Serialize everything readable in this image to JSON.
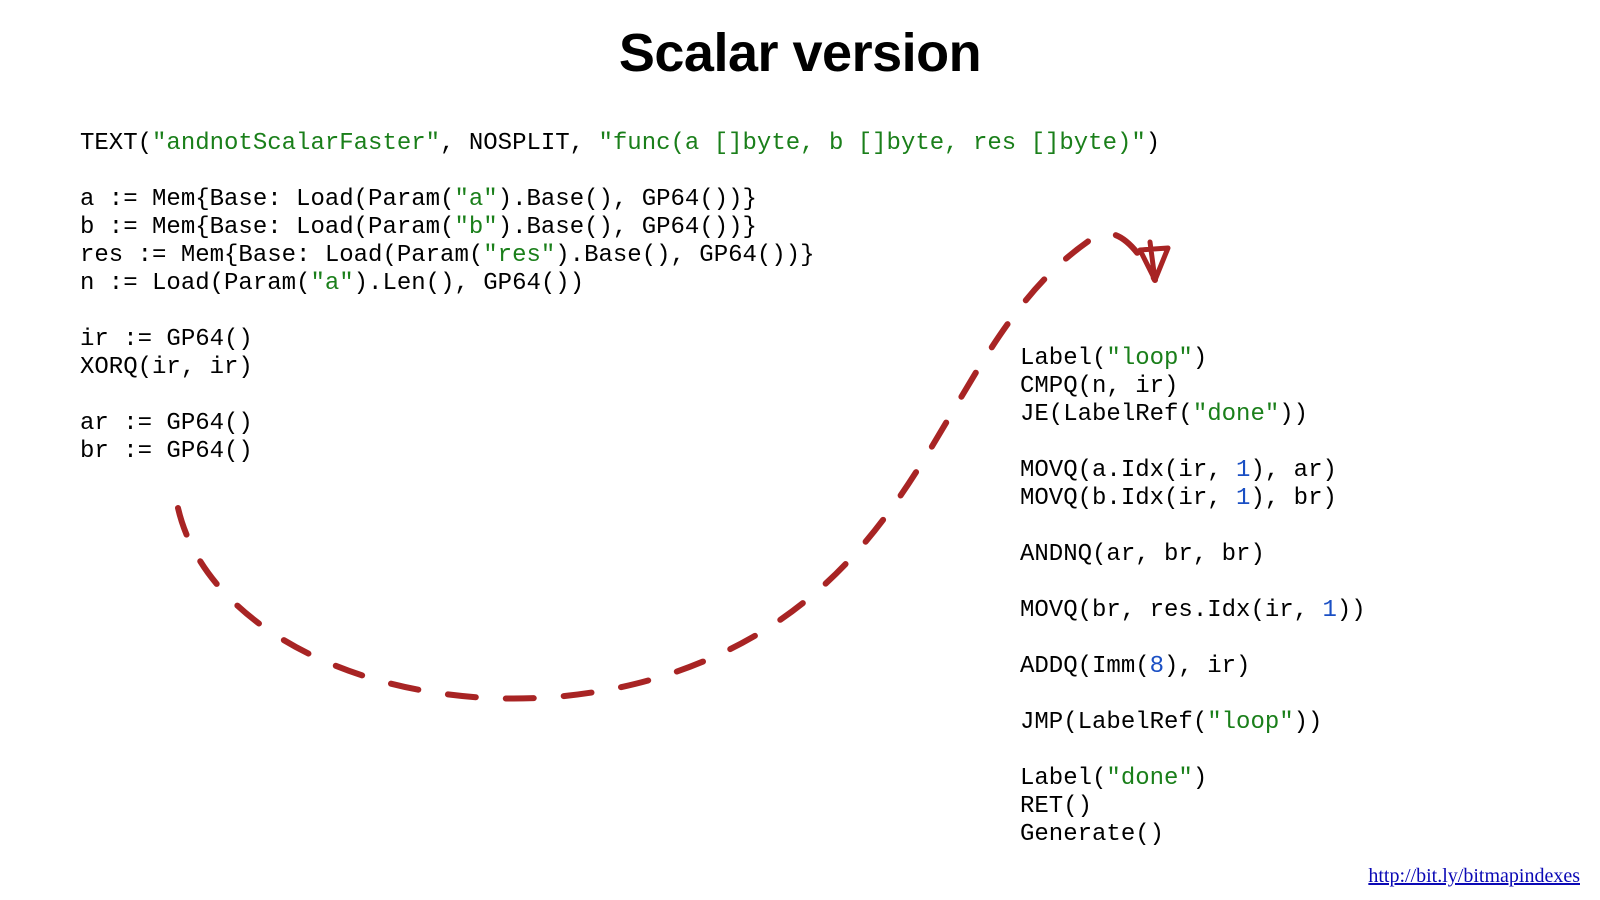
{
  "title": "Scalar version",
  "footer_link": "http://bit.ly/bitmapindexes",
  "strings": {
    "fn_name": "\"andnotScalarFaster\"",
    "fn_sig": "\"func(a []byte, b []byte, res []byte)\"",
    "a": "\"a\"",
    "b": "\"b\"",
    "res": "\"res\"",
    "loop": "\"loop\"",
    "done": "\"done\""
  },
  "nums": {
    "one_a": "1",
    "one_b": "1",
    "one_c": "1",
    "eight": "8"
  },
  "tokens": {
    "left_l1a": "TEXT(",
    "left_l1b": ", NOSPLIT, ",
    "left_l1c": ")",
    "left_l3a": "a := Mem{Base: Load(Param(",
    "left_l3b": ").Base(), GP64())}",
    "left_l4a": "b := Mem{Base: Load(Param(",
    "left_l4b": ").Base(), GP64())}",
    "left_l5a": "res := Mem{Base: Load(Param(",
    "left_l5b": ").Base(), GP64())}",
    "left_l6a": "n := Load(Param(",
    "left_l6b": ").Len(), GP64())",
    "left_l8": "ir := GP64()",
    "left_l9": "XORQ(ir, ir)",
    "left_l11": "ar := GP64()",
    "left_l12": "br := GP64()",
    "right_l1a": "Label(",
    "right_l1b": ")",
    "right_l2": "CMPQ(n, ir)",
    "right_l3a": "JE(LabelRef(",
    "right_l3b": "))",
    "right_l5a": "MOVQ(a.Idx(ir, ",
    "right_l5b": "), ar)",
    "right_l6a": "MOVQ(b.Idx(ir, ",
    "right_l6b": "), br)",
    "right_l8": "ANDNQ(ar, br, br)",
    "right_l10a": "MOVQ(br, res.Idx(ir, ",
    "right_l10b": "))",
    "right_l12a": "ADDQ(Imm(",
    "right_l12b": "), ir)",
    "right_l14a": "JMP(LabelRef(",
    "right_l14b": "))",
    "right_l16a": "Label(",
    "right_l16b": ")",
    "right_l17": "RET()",
    "right_l18": "Generate()"
  },
  "arrow_color": "#a82424"
}
